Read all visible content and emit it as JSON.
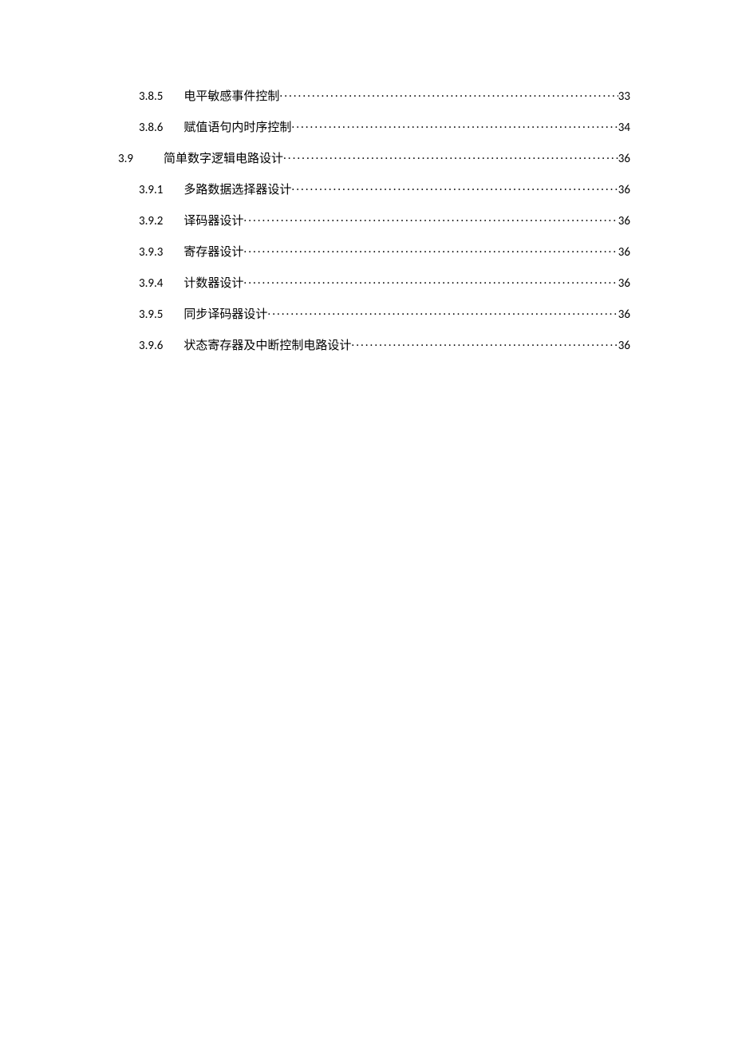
{
  "toc": [
    {
      "level": 2,
      "num": "3.8.5",
      "title": "电平敏感事件控制",
      "page": "33"
    },
    {
      "level": 2,
      "num": "3.8.6",
      "title": "赋值语句内时序控制",
      "page": "34"
    },
    {
      "level": 1,
      "num": "3.9",
      "title": "简单数字逻辑电路设计",
      "page": "36"
    },
    {
      "level": 2,
      "num": "3.9.1",
      "title": "多路数据选择器设计",
      "page": "36"
    },
    {
      "level": 2,
      "num": "3.9.2",
      "title": "译码器设计",
      "page": "36"
    },
    {
      "level": 2,
      "num": "3.9.3",
      "title": "寄存器设计",
      "page": "36"
    },
    {
      "level": 2,
      "num": "3.9.4",
      "title": "计数器设计",
      "page": "36"
    },
    {
      "level": 2,
      "num": "3.9.5",
      "title": "同步译码器设计",
      "page": "36"
    },
    {
      "level": 2,
      "num": "3.9.6",
      "title": "状态寄存器及中断控制电路设计",
      "page": "36"
    }
  ]
}
